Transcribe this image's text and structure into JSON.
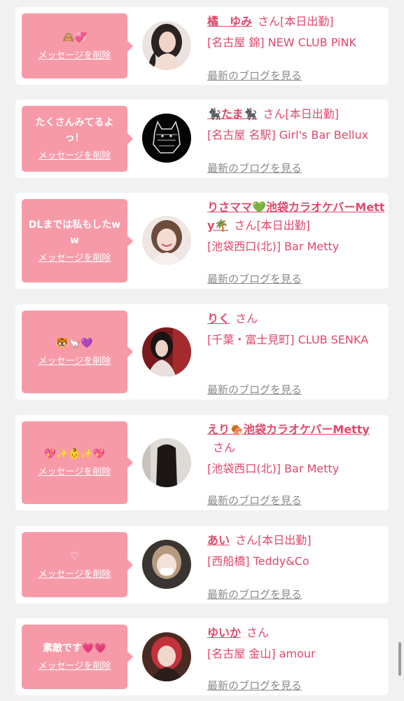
{
  "delete_label": "メッセージを削除",
  "blog_label": "最新のブログを見る",
  "san_label": "さん",
  "cards": [
    {
      "message": "🙈💞",
      "name": "橘　ゆみ",
      "work": "[本日出勤]",
      "shop": "[名古屋 錦] NEW CLUB PiNK",
      "avatar": "avatar-woman-dark-hair"
    },
    {
      "message": "たくさんみてるよっ！",
      "name": "🐈‍⬛たま🐈‍⬛",
      "work": "[本日出勤]",
      "shop": "[名古屋 名駅] Girl's Bar Bellux",
      "avatar": "avatar-cat-drawing"
    },
    {
      "message": "DLまでは私もしたww",
      "name": "りさママ💚池袋カラオケバーMetty🌴",
      "work": "[本日出勤]",
      "shop": "[池袋西口(北)] Bar Metty",
      "avatar": "avatar-woman-smiling"
    },
    {
      "message": "🐯🦙💜",
      "name": "りく",
      "work": "",
      "shop": "[千葉・富士見町] CLUB SENKA",
      "avatar": "avatar-woman-red-room"
    },
    {
      "message": "💖✨👶✨💖",
      "name": "えり🍖池袋カラオケバーMetty",
      "work": "",
      "shop": "[池袋西口(北)] Bar Metty",
      "avatar": "avatar-woman-long-hair-back"
    },
    {
      "message": "♡",
      "name": "あい",
      "work": "[本日出勤]",
      "shop": "[西船橋] Teddy&Co",
      "avatar": "avatar-woman-blonde"
    },
    {
      "message": "素敵です💗💗",
      "name": "ゆいか",
      "work": "",
      "shop": "[名古屋 金山] amour",
      "avatar": "avatar-woman-red-hair"
    }
  ]
}
